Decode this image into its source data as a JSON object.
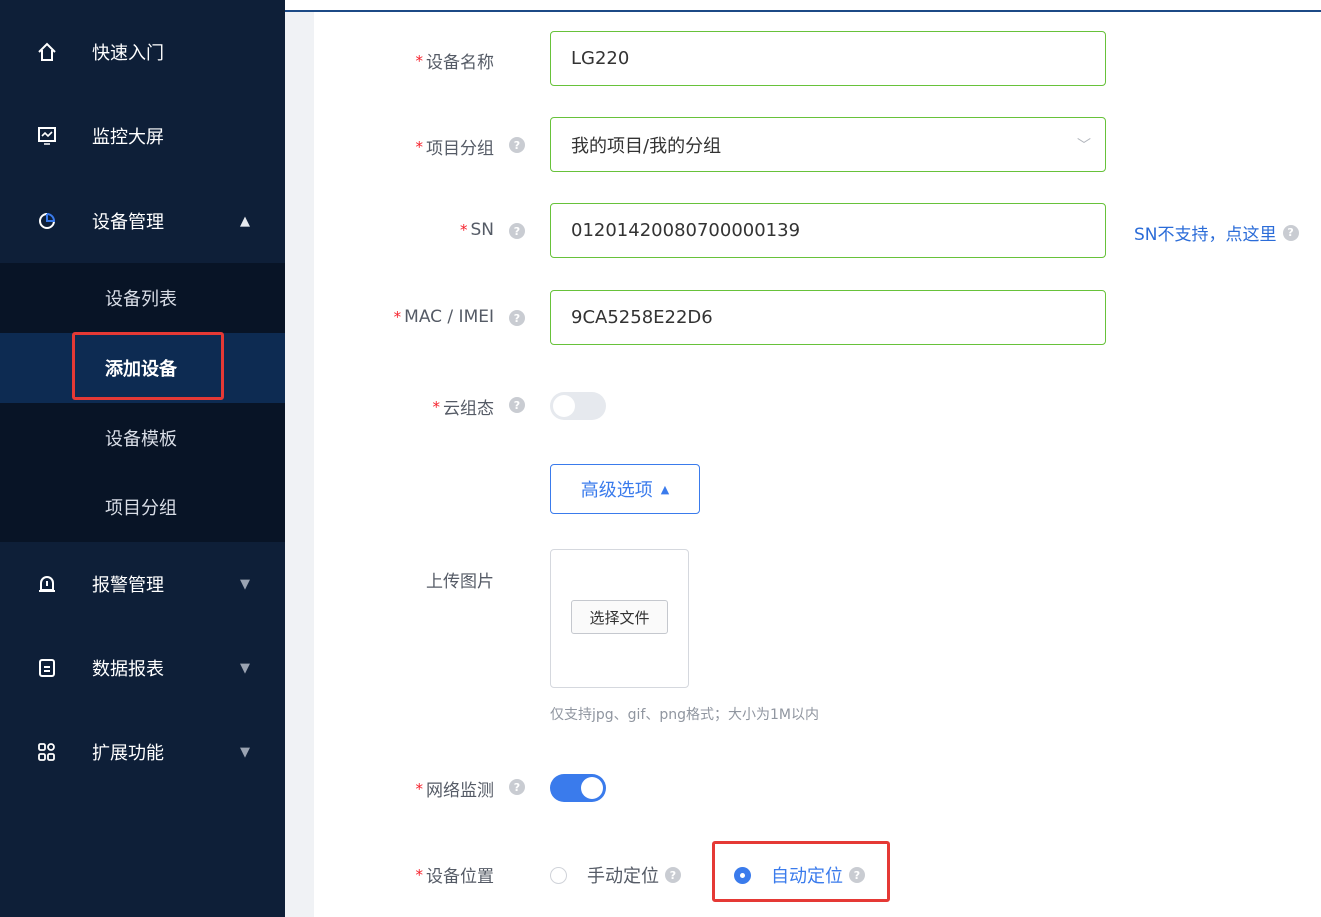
{
  "sidebar": {
    "items": [
      {
        "label": "快速入门",
        "icon": "home-icon",
        "glyph": "⌂"
      },
      {
        "label": "监控大屏",
        "icon": "monitor-icon",
        "glyph": "▭"
      },
      {
        "label": "设备管理",
        "icon": "pie-chart-icon",
        "glyph": "◔",
        "expanded": true
      },
      {
        "label": "报警管理",
        "icon": "alarm-icon",
        "glyph": "⍾"
      },
      {
        "label": "数据报表",
        "icon": "report-icon",
        "glyph": "▤"
      },
      {
        "label": "扩展功能",
        "icon": "apps-icon",
        "glyph": "⁘"
      }
    ],
    "device_submenu": [
      {
        "label": "设备列表"
      },
      {
        "label": "添加设备",
        "active": true
      },
      {
        "label": "设备模板"
      },
      {
        "label": "项目分组"
      }
    ]
  },
  "form": {
    "device_name": {
      "label": "设备名称",
      "value": "LG220"
    },
    "project_group": {
      "label": "项目分组",
      "value": "我的项目/我的分组"
    },
    "sn": {
      "label": "SN",
      "value": "01201420080700000139",
      "link": "SN不支持，点这里"
    },
    "mac_imei": {
      "label": "MAC / IMEI",
      "value": "9CA5258E22D6"
    },
    "cloud_config": {
      "label": "云组态",
      "enabled": false
    },
    "advanced": {
      "label": "高级选项"
    },
    "upload": {
      "label": "上传图片",
      "button": "选择文件",
      "hint": "仅支持jpg、gif、png格式；大小为1M以内"
    },
    "network_monitor": {
      "label": "网络监测",
      "enabled": true
    },
    "location": {
      "label": "设备位置",
      "options": [
        "手动定位",
        "自动定位"
      ],
      "selected": "自动定位"
    }
  },
  "colors": {
    "sidebar_bg": "#0e1f38",
    "accent": "#3a7bec",
    "valid_border": "#67c23a",
    "required": "#f5222d",
    "highlight": "#e53935"
  }
}
